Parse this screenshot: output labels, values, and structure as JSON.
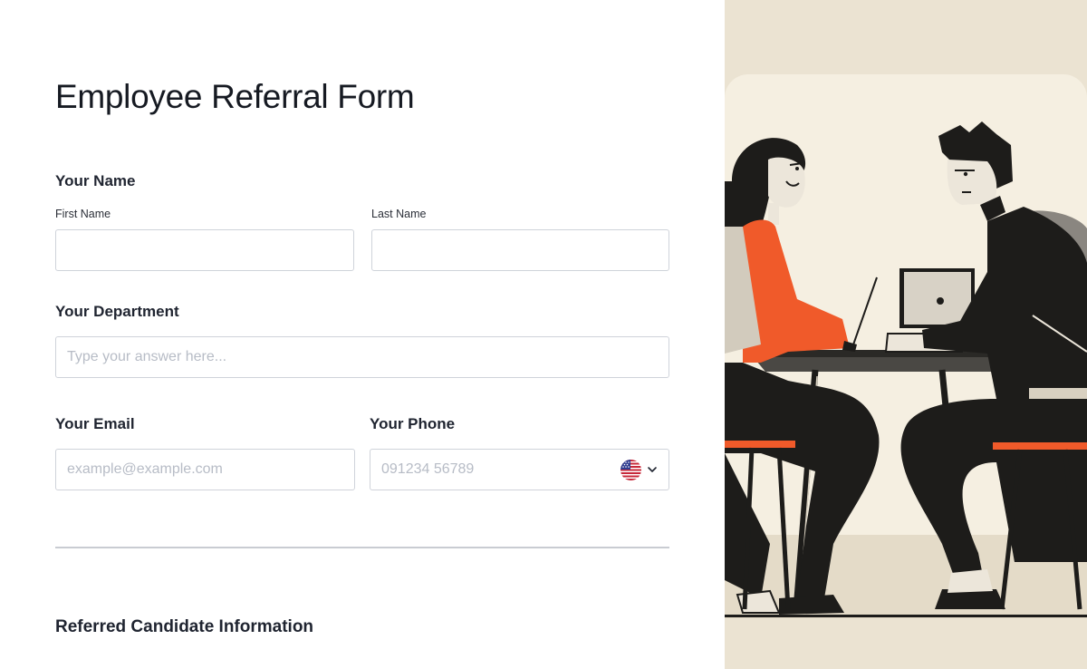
{
  "form": {
    "title": "Employee Referral Form",
    "your_name": {
      "label": "Your Name",
      "first_name_label": "First Name",
      "first_name_value": "",
      "last_name_label": "Last Name",
      "last_name_value": ""
    },
    "department": {
      "label": "Your Department",
      "placeholder": "Type your answer here..."
    },
    "email": {
      "label": "Your Email",
      "placeholder": "example@example.com"
    },
    "phone": {
      "label": "Your Phone",
      "placeholder": "091234 56789",
      "country_flag_icon": "us-flag-icon"
    },
    "candidate_section_title": "Referred Candidate Information"
  },
  "colors": {
    "accent_orange": "#f05a2a",
    "illustration_bg": "#ece4d4",
    "ink": "#1d1c1a"
  }
}
